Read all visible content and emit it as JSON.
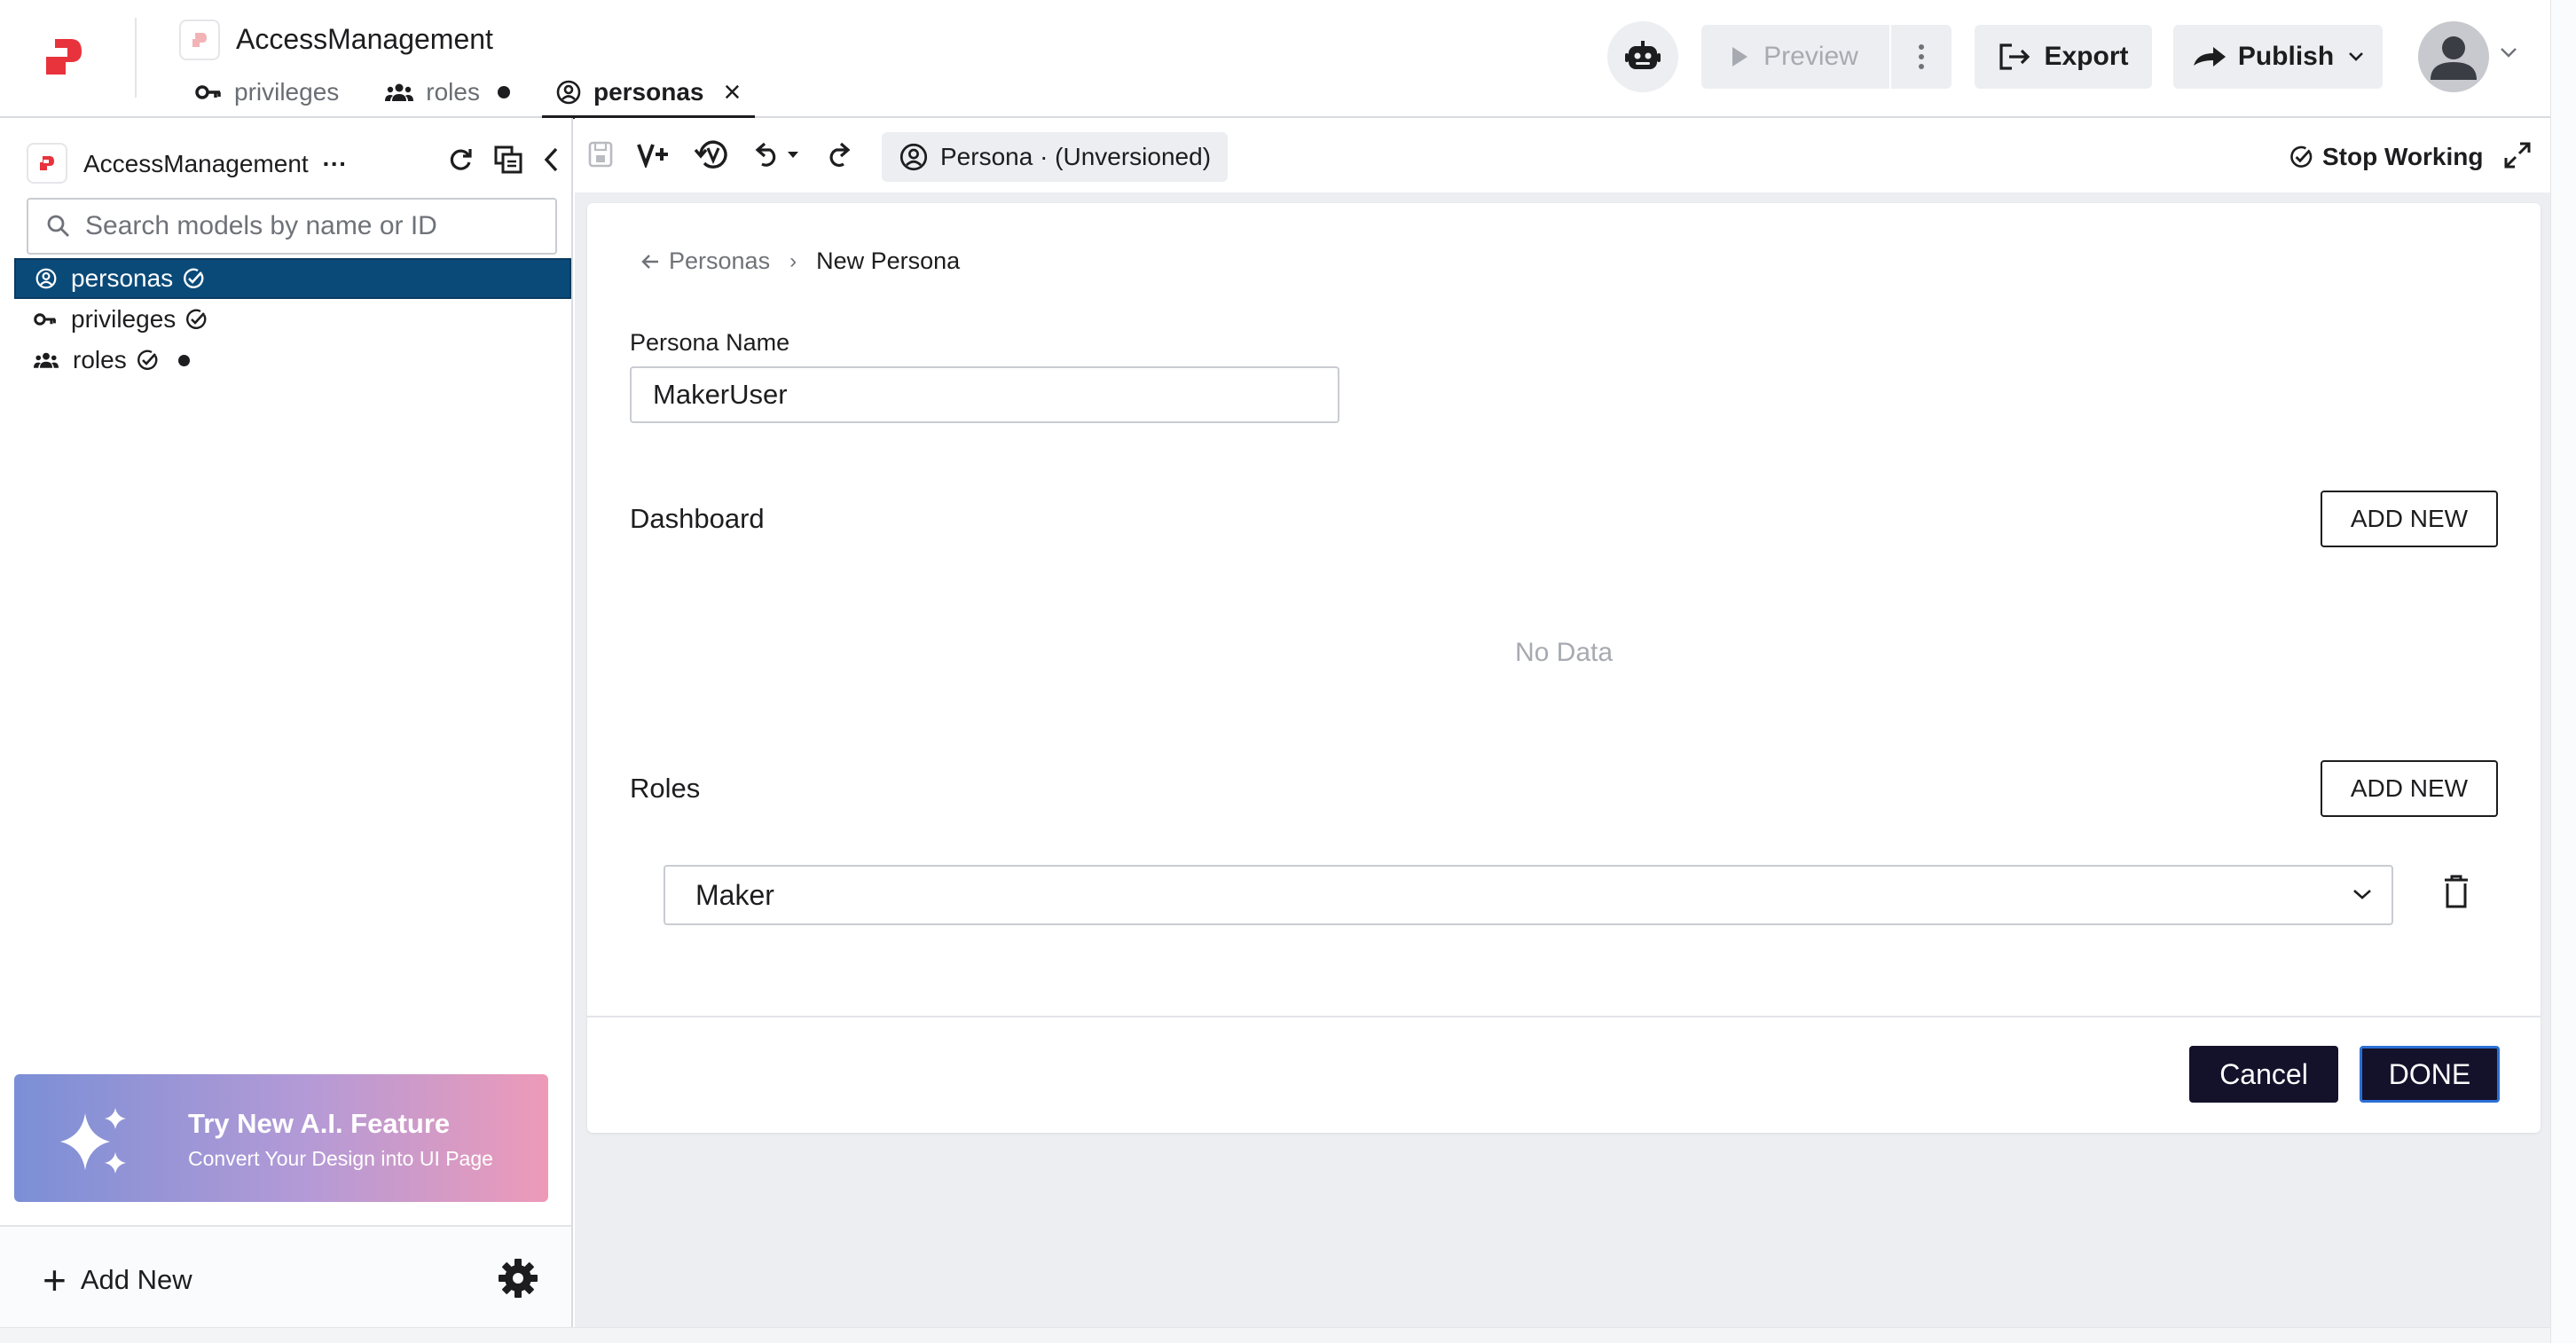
{
  "app": {
    "title": "AccessManagement"
  },
  "tabs": [
    {
      "label": "privileges",
      "icon": "key-icon"
    },
    {
      "label": "roles",
      "icon": "group-icon",
      "unsaved": true
    },
    {
      "label": "personas",
      "icon": "person-circle-icon",
      "active": true
    }
  ],
  "header": {
    "preview_label": "Preview",
    "export_label": "Export",
    "publish_label": "Publish"
  },
  "sidebar": {
    "title": "AccessManagement",
    "title_more": "···",
    "search_placeholder": "Search models by name or ID",
    "items": [
      {
        "label": "personas",
        "icon": "person-circle-icon",
        "selected": true
      },
      {
        "label": "privileges",
        "icon": "key-icon"
      },
      {
        "label": "roles",
        "icon": "group-icon",
        "unsaved": true
      }
    ],
    "ai_banner": {
      "title": "Try New A.I. Feature",
      "subtitle": "Convert Your Design into UI Page"
    },
    "add_new_label": "Add New"
  },
  "toolbar": {
    "version_label": "Persona · (Unversioned)",
    "stop_working_label": "Stop Working"
  },
  "form": {
    "breadcrumb_parent": "Personas",
    "breadcrumb_current": "New Persona",
    "persona_name_label": "Persona Name",
    "persona_name_value": "MakerUser",
    "dashboard_title": "Dashboard",
    "dashboard_add_label": "ADD NEW",
    "dashboard_empty": "No Data",
    "roles_title": "Roles",
    "roles_add_label": "ADD NEW",
    "role_selected": "Maker",
    "cancel_label": "Cancel",
    "done_label": "DONE"
  },
  "colors": {
    "brand": "#e8323c",
    "selected_row": "#0a4a78",
    "primary_button": "#14122b",
    "focus_ring": "#2b6fd6"
  }
}
